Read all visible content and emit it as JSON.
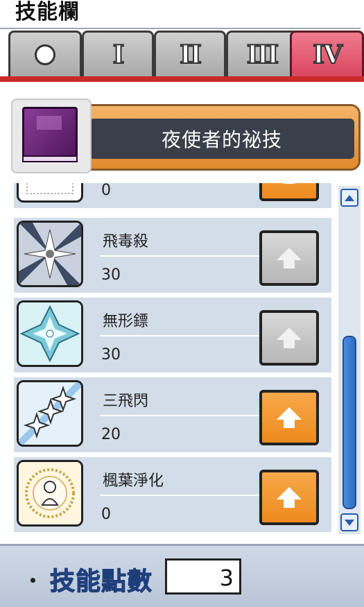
{
  "window": {
    "title": "技能欄"
  },
  "tabs": [
    {
      "label": "",
      "icon": "circle"
    },
    {
      "label": "I"
    },
    {
      "label": "II"
    },
    {
      "label": "III"
    },
    {
      "label": "IV",
      "active": true
    }
  ],
  "class_header": {
    "name": "夜使者的祕技",
    "icon": "purple-book-icon"
  },
  "skills": [
    {
      "name": "",
      "level": "0",
      "icon": "partial-skill-icon",
      "upgrade_enabled": true
    },
    {
      "name": "飛毒殺",
      "level": "30",
      "icon": "star-burst-icon",
      "upgrade_enabled": false
    },
    {
      "name": "無形鏢",
      "level": "30",
      "icon": "shuriken-icon",
      "upgrade_enabled": false
    },
    {
      "name": "三飛閃",
      "level": "20",
      "icon": "triple-star-icon",
      "upgrade_enabled": true
    },
    {
      "name": "楓葉淨化",
      "level": "0",
      "icon": "maple-purify-icon",
      "upgrade_enabled": true
    }
  ],
  "footer": {
    "label": "技能點數",
    "value": "3"
  },
  "colors": {
    "accent_tab": "#d9485f",
    "upgrade_button": "#ee8a1e",
    "row_bg": "#d3dde9",
    "label_blue": "#2f5aa3"
  }
}
